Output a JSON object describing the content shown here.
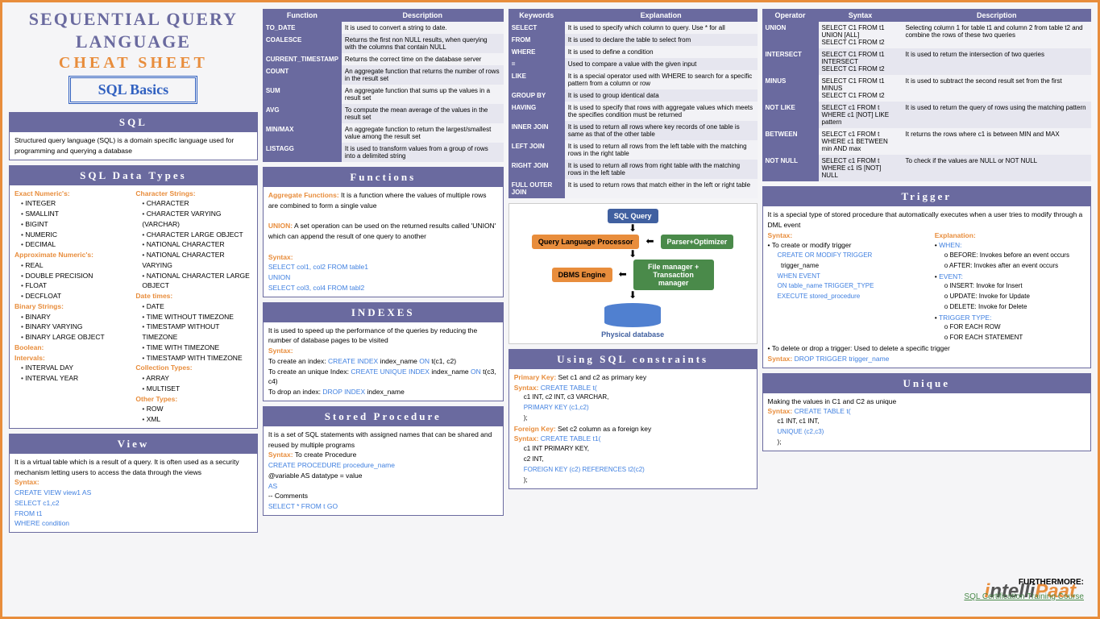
{
  "title1": "SEQUENTIAL QUERY",
  "title2": "LANGUAGE",
  "title3": "CHEAT SHEET",
  "basics": "SQL Basics",
  "sql": {
    "h": "SQL",
    "t": "Structured query language (SQL) is a domain specific language used for programming and querying a database"
  },
  "types": {
    "h": "SQL Data Types",
    "exact": {
      "h": "Exact Numeric's:",
      "items": [
        "INTEGER",
        "SMALLINT",
        "BIGINT",
        "NUMERIC",
        "DECIMAL"
      ]
    },
    "approx": {
      "h": "Approximate Numeric's:",
      "items": [
        "REAL",
        "DOUBLE PRECISION",
        "FLOAT",
        "DECFLOAT"
      ]
    },
    "binary": {
      "h": "Binary Strings:",
      "items": [
        "BINARY",
        "BINARY VARYING",
        "BINARY LARGE OBJECT"
      ]
    },
    "bool": {
      "h": "Boolean:"
    },
    "interval": {
      "h": "Intervals:",
      "items": [
        "INTERVAL DAY",
        "INTERVAL YEAR"
      ]
    },
    "char": {
      "h": "Character Strings:",
      "items": [
        "CHARACTER",
        "CHARACTER VARYING (VARCHAR)",
        "CHARACTER LARGE OBJECT",
        "NATIONAL CHARACTER",
        "NATIONAL CHARACTER VARYING",
        "NATIONAL CHARACTER LARGE OBJECT"
      ]
    },
    "date": {
      "h": "Date times:",
      "items": [
        "DATE",
        "TIME WITHOUT TIMEZONE",
        "TIMESTAMP WITHOUT TIMEZONE",
        "TIME WITH TIMEZONE",
        "TIMESTAMP WITH TIMEZONE"
      ]
    },
    "coll": {
      "h": "Collection Types:",
      "items": [
        "ARRAY",
        "MULTISET"
      ]
    },
    "other": {
      "h": "Other Types:",
      "items": [
        "ROW",
        "XML"
      ]
    }
  },
  "view": {
    "h": "View",
    "t": "It is a virtual table which is a result of a query. It is often used as a security mechanism letting users to access the data through the views",
    "syn": "Syntax:",
    "c1": "CREATE VIEW view1 AS",
    "c2": "SELECT c1,c2",
    "c3": "FROM t1",
    "c4": "WHERE condition"
  },
  "fntable": {
    "h1": "Function",
    "h2": "Description",
    "rows": [
      [
        "TO_DATE",
        "It is used to convert a string to date."
      ],
      [
        "COALESCE",
        "Returns the first non NULL results, when querying with the columns that contain NULL"
      ],
      [
        "CURRENT_TIMESTAMP",
        "Returns the correct time on the database server"
      ],
      [
        "COUNT",
        "An aggregate function that returns the number of rows in the result set"
      ],
      [
        "SUM",
        "An aggregate function that sums up the values in a result set"
      ],
      [
        "AVG",
        "To compute the mean average of the values in the result set"
      ],
      [
        "MIN/MAX",
        "An aggregate function to return the largest/smallest value among the result set"
      ],
      [
        "LISTAGG",
        "It is used to transform values from a group of rows into a delimited string"
      ]
    ]
  },
  "func": {
    "h": "Functions",
    "af": "Aggregate Functions:",
    "aft": " It is a function where the values of multiple rows are combined to form a single value",
    "un": "UNION:",
    "unt": " A set operation can be used on the returned results called 'UNION' which can append the result of one query to another",
    "syn": "Syntax:",
    "c1": "SELECT col1, col2 FROM table1",
    "c2": "UNION",
    "c3": "SELECT col3, col4 FROM tabl2"
  },
  "idx": {
    "h": "INDEXES",
    "t": "It is used to speed up the performance of the queries by reducing the number of database pages to be visited",
    "syn": "Syntax:",
    "c1a": "To create an index: ",
    "c1b": "CREATE INDEX",
    "c1c": " index_name ",
    "c1d": "ON",
    "c1e": " t(c1, c2)",
    "c2a": "To create an unique Index: ",
    "c2b": "CREATE UNIQUE INDEX",
    "c2c": " index_name ",
    "c2d": "ON",
    "c2e": " t(c3, c4)",
    "c3a": "To drop an index: ",
    "c3b": "DROP INDEX",
    "c3c": " index_name"
  },
  "sp": {
    "h": "Stored Procedure",
    "t": "It is a set of SQL statements with assigned names that can be shared and reused by multiple programs",
    "syn": "Syntax:",
    "synt": " To create Procedure",
    "c1": "CREATE PROCEDURE procedure_name",
    "c2": "@variable AS datatype = value",
    "c3": "AS",
    "c4": "-- Comments",
    "c5": "SELECT * FROM t GO"
  },
  "kwtable": {
    "h1": "Keywords",
    "h2": "Explanation",
    "rows": [
      [
        "SELECT",
        "It is used to specify which column to query. Use * for all"
      ],
      [
        "FROM",
        "It is used to declare the table to select from"
      ],
      [
        "WHERE",
        "It is used to define a condition"
      ],
      [
        "=",
        "Used to compare a value with the given input"
      ],
      [
        "LIKE",
        "It is a special operator used with WHERE to search for a specific pattern from a column or row"
      ],
      [
        "GROUP BY",
        "It is used to group identical data"
      ],
      [
        "HAVING",
        "It is used to specify that rows with aggregate values which meets the specifies condition must be returned"
      ],
      [
        "INNER JOIN",
        "It is used to return all rows where key records of one table is same as that of the other table"
      ],
      [
        "LEFT JOIN",
        "It is used to return all rows from the left table with the matching rows in the right table"
      ],
      [
        "RIGHT JOIN",
        "It is used to return all rows from right table with the matching rows in the left table"
      ],
      [
        "FULL OUTER JOIN",
        "It is used to return rows that match either in the left or right table"
      ]
    ]
  },
  "diag": {
    "q": "SQL Query",
    "p": "Query Language Processor",
    "po": "Parser+Optimizer",
    "e": "DBMS Engine",
    "fm": "File manager + Transaction manager",
    "pd": "Physical database"
  },
  "con": {
    "h": "Using SQL constraints",
    "pk": "Primary Key:",
    "pkt": " Set c1 and c2 as primary key",
    "syn": "Syntax:",
    "c1": "CREATE TABLE t(",
    "c2": "c1 INT, c2 INT, c3 VARCHAR,",
    "c3": "PRIMARY KEY (c1,c2)",
    "c4": ");",
    "fk": "Foreign Key:",
    "fkt": " Set c2 column as a foreign key",
    "f1": "CREATE TABLE t1(",
    "f2": "c1 INT PRIMARY KEY,",
    "f3": "c2 INT,",
    "f4": "FOREIGN KEY (c2) REFERENCES t2(c2)",
    "f5": ");"
  },
  "optable": {
    "h1": "Operator",
    "h2": "Syntax",
    "h3": "Description",
    "rows": [
      [
        "UNION",
        "SELECT C1 FROM t1\nUNION [ALL]\nSELECT C1 FROM t2",
        "Selecting column 1 for table t1 and column 2 from table t2 and combine the rows of these two queries"
      ],
      [
        "INTERSECT",
        "SELECT C1 FROM t1\nINTERSECT\nSELECT C1 FROM t2",
        "It is used to return the intersection of two queries"
      ],
      [
        "MINUS",
        "SELECT C1 FROM t1\nMINUS\nSELECT C1 FROM t2",
        "It is used to subtract the second result set from the first"
      ],
      [
        "NOT LIKE",
        "SELECT c1 FROM t\nWHERE c1 [NOT] LIKE pattern",
        "It is used to return the query of rows using the matching pattern"
      ],
      [
        "BETWEEN",
        "SELECT c1 FROM t\nWHERE c1 BETWEEN min AND max",
        "It returns the rows where c1 is between MIN and MAX"
      ],
      [
        "NOT NULL",
        "SELECT c1 FROM t\nWHERE c1 IS [NOT] NULL",
        "To check if the values are NULL or NOT NULL"
      ]
    ]
  },
  "trig": {
    "h": "Trigger",
    "t": "It is a special type of stored procedure that automatically executes when a user tries to modify through a DML event",
    "syn": "Syntax:",
    "s1": "To create or modify trigger",
    "c1": "CREATE OR MODIFY TRIGGER",
    "c1a": "trigger_name",
    "c2": "WHEN EVENT",
    "c3": "ON table_name TRIGGER_TYPE",
    "c4": "EXECUTE stored_procedure",
    "ex": "Explanation:",
    "w": "WHEN:",
    "w1": "BEFORE: Invokes before an event occurs",
    "w2": "AFTER: Invokes after an event occurs",
    "ev": "EVENT:",
    "e1": "INSERT: Invoke for Insert",
    "e2": "UPDATE: Invoke for Update",
    "e3": "DELETE: Invoke for Delete",
    "tt": "TRIGGER TYPE:",
    "t1": "FOR EACH ROW",
    "t2": "FOR EACH STATEMENT",
    "del": "To delete or drop a trigger: Used to delete a specific trigger",
    "ds": "Syntax:",
    "dc": "DROP TRIGGER trigger_name"
  },
  "uniq": {
    "h": "Unique",
    "t": "Making the values in C1 and C2 as unique",
    "syn": "Syntax:",
    "c1": "CREATE TABLE t(",
    "c2": "c1 INT, c1 INT,",
    "c3": "UNIQUE (c2,c3)",
    "c4": ");"
  },
  "logo1": "i",
  "logo2": "ntelli",
  "logo3": "Paat",
  "further": "FURTHERMORE:",
  "link": "SQL Certification Training Course"
}
